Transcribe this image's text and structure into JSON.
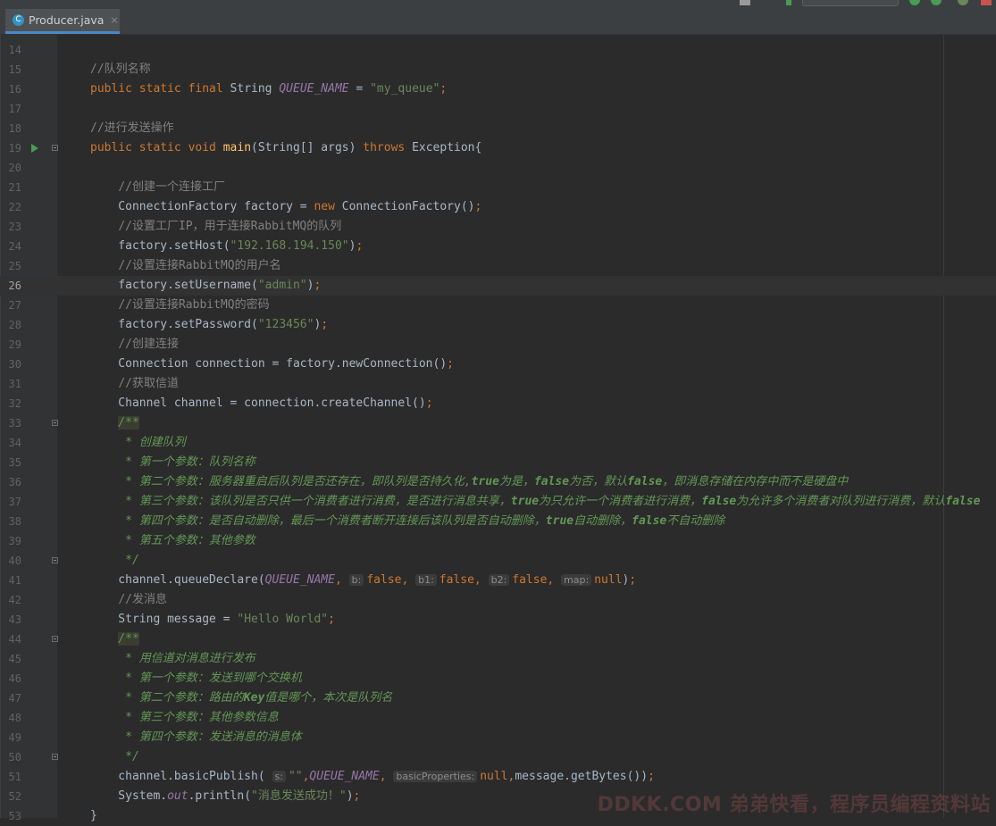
{
  "editor": {
    "tab": {
      "filename": "Producer.java",
      "icon": "java-class-icon",
      "close_glyph": "×"
    },
    "current_line": 26
  },
  "watermark": "DDKK.COM 弟弟快看，程序员编程资料站",
  "lines": [
    {
      "n": "14",
      "tokens": []
    },
    {
      "n": "15",
      "tokens": [
        {
          "c": "cmt",
          "t": "//队列名称"
        }
      ]
    },
    {
      "n": "16",
      "tokens": [
        {
          "c": "kw",
          "t": "public static final "
        },
        {
          "c": "cl",
          "t": "String "
        },
        {
          "c": "fld",
          "t": "QUEUE_NAME"
        },
        {
          "c": "plain",
          "t": " = "
        },
        {
          "c": "str",
          "t": "\"my_queue\""
        },
        {
          "c": "kw",
          "t": ";"
        }
      ]
    },
    {
      "n": "17",
      "tokens": []
    },
    {
      "n": "18",
      "tokens": [
        {
          "c": "cmt",
          "t": "//进行发送操作"
        }
      ]
    },
    {
      "n": "19",
      "run": true,
      "fold": true,
      "tokens": [
        {
          "c": "kw",
          "t": "public static void "
        },
        {
          "c": "mth",
          "t": "main"
        },
        {
          "c": "plain",
          "t": "(String[] args) "
        },
        {
          "c": "kw",
          "t": "throws "
        },
        {
          "c": "plain",
          "t": "Exception{"
        }
      ]
    },
    {
      "n": "20",
      "tokens": []
    },
    {
      "n": "21",
      "tokens": [
        {
          "c": "plain",
          "t": "    "
        },
        {
          "c": "cmt",
          "t": "//创建一个连接工厂"
        }
      ]
    },
    {
      "n": "22",
      "tokens": [
        {
          "c": "plain",
          "t": "    ConnectionFactory factory = "
        },
        {
          "c": "kw",
          "t": "new "
        },
        {
          "c": "plain",
          "t": "ConnectionFactory()"
        },
        {
          "c": "kw",
          "t": ";"
        }
      ]
    },
    {
      "n": "23",
      "tokens": [
        {
          "c": "plain",
          "t": "    "
        },
        {
          "c": "cmt",
          "t": "//设置工厂IP，用于连接RabbitMQ的队列"
        }
      ]
    },
    {
      "n": "24",
      "tokens": [
        {
          "c": "plain",
          "t": "    factory.setHost("
        },
        {
          "c": "str",
          "t": "\"192.168.194.150\""
        },
        {
          "c": "plain",
          "t": ")"
        },
        {
          "c": "kw",
          "t": ";"
        }
      ]
    },
    {
      "n": "25",
      "tokens": [
        {
          "c": "plain",
          "t": "    "
        },
        {
          "c": "cmt",
          "t": "//设置连接RabbitMQ的用户名"
        }
      ]
    },
    {
      "n": "26",
      "tokens": [
        {
          "c": "plain",
          "t": "    factory.setUsername("
        },
        {
          "c": "str",
          "t": "\"admin\""
        },
        {
          "c": "plain",
          "t": ")"
        },
        {
          "c": "kw",
          "t": ";"
        }
      ]
    },
    {
      "n": "27",
      "tokens": [
        {
          "c": "plain",
          "t": "    "
        },
        {
          "c": "cmt",
          "t": "//设置连接RabbitMQ的密码"
        }
      ]
    },
    {
      "n": "28",
      "tokens": [
        {
          "c": "plain",
          "t": "    factory.setPassword("
        },
        {
          "c": "str",
          "t": "\"123456\""
        },
        {
          "c": "plain",
          "t": ")"
        },
        {
          "c": "kw",
          "t": ";"
        }
      ]
    },
    {
      "n": "29",
      "tokens": [
        {
          "c": "plain",
          "t": "    "
        },
        {
          "c": "cmt",
          "t": "//创建连接"
        }
      ]
    },
    {
      "n": "30",
      "tokens": [
        {
          "c": "plain",
          "t": "    Connection connection = factory.newConnection()"
        },
        {
          "c": "kw",
          "t": ";"
        }
      ]
    },
    {
      "n": "31",
      "tokens": [
        {
          "c": "plain",
          "t": "    "
        },
        {
          "c": "cmt",
          "t": "//获取信道"
        }
      ]
    },
    {
      "n": "32",
      "tokens": [
        {
          "c": "plain",
          "t": "    Channel channel = connection.createChannel()"
        },
        {
          "c": "kw",
          "t": ";"
        }
      ]
    },
    {
      "n": "33",
      "fold": true,
      "tokens": [
        {
          "c": "plain",
          "t": "    "
        },
        {
          "c": "docs",
          "t": "/**"
        }
      ]
    },
    {
      "n": "34",
      "tokens": [
        {
          "c": "doc",
          "t": "     * 创建队列"
        }
      ]
    },
    {
      "n": "35",
      "tokens": [
        {
          "c": "doc",
          "t": "     * 第一个参数：队列名称"
        }
      ]
    },
    {
      "n": "36",
      "tokens": [
        {
          "c": "doc",
          "t": "     * 第二个参数：服务器重启后队列是否还存在，即队列是否持久化,"
        },
        {
          "c": "doc-b",
          "t": "true"
        },
        {
          "c": "doc",
          "t": "为是，"
        },
        {
          "c": "doc-b",
          "t": "false"
        },
        {
          "c": "doc",
          "t": "为否，默认"
        },
        {
          "c": "doc-b",
          "t": "false"
        },
        {
          "c": "doc",
          "t": "，即消息存储在内存中而不是硬盘中"
        }
      ]
    },
    {
      "n": "37",
      "tokens": [
        {
          "c": "doc",
          "t": "     * 第三个参数：该队列是否只供一个消费者进行消费，是否进行消息共享，"
        },
        {
          "c": "doc-b",
          "t": "true"
        },
        {
          "c": "doc",
          "t": "为只允许一个消费者进行消费，"
        },
        {
          "c": "doc-b",
          "t": "false"
        },
        {
          "c": "doc",
          "t": "为允许多个消费者对队列进行消费，默认"
        },
        {
          "c": "doc-b",
          "t": "false"
        }
      ]
    },
    {
      "n": "38",
      "tokens": [
        {
          "c": "doc",
          "t": "     * 第四个参数：是否自动删除，最后一个消费者断开连接后该队列是否自动删除，"
        },
        {
          "c": "doc-b",
          "t": "true"
        },
        {
          "c": "doc",
          "t": "自动删除，"
        },
        {
          "c": "doc-b",
          "t": "false"
        },
        {
          "c": "doc",
          "t": "不自动删除"
        }
      ]
    },
    {
      "n": "39",
      "tokens": [
        {
          "c": "doc",
          "t": "     * 第五个参数：其他参数"
        }
      ]
    },
    {
      "n": "40",
      "fold": true,
      "tokens": [
        {
          "c": "doc",
          "t": "     */"
        }
      ]
    },
    {
      "n": "41",
      "tokens": [
        {
          "c": "plain",
          "t": "    channel.queueDeclare("
        },
        {
          "c": "fld",
          "t": "QUEUE_NAME"
        },
        {
          "c": "kw",
          "t": ", "
        },
        {
          "c": "hint",
          "t": "b:"
        },
        {
          "c": "kw",
          "t": "false, "
        },
        {
          "c": "hint",
          "t": "b1:"
        },
        {
          "c": "kw",
          "t": "false, "
        },
        {
          "c": "hint",
          "t": "b2:"
        },
        {
          "c": "kw",
          "t": "false, "
        },
        {
          "c": "hint",
          "t": "map:"
        },
        {
          "c": "kw",
          "t": "null"
        },
        {
          "c": "plain",
          "t": ")"
        },
        {
          "c": "kw",
          "t": ";"
        }
      ]
    },
    {
      "n": "42",
      "tokens": [
        {
          "c": "plain",
          "t": "    "
        },
        {
          "c": "cmt",
          "t": "//发消息"
        }
      ]
    },
    {
      "n": "43",
      "tokens": [
        {
          "c": "plain",
          "t": "    String message = "
        },
        {
          "c": "str",
          "t": "\"Hello World\""
        },
        {
          "c": "kw",
          "t": ";"
        }
      ]
    },
    {
      "n": "44",
      "fold": true,
      "tokens": [
        {
          "c": "plain",
          "t": "    "
        },
        {
          "c": "docs",
          "t": "/**"
        }
      ]
    },
    {
      "n": "45",
      "tokens": [
        {
          "c": "doc",
          "t": "     * 用信道对消息进行发布"
        }
      ]
    },
    {
      "n": "46",
      "tokens": [
        {
          "c": "doc",
          "t": "     * 第一个参数：发送到哪个交换机"
        }
      ]
    },
    {
      "n": "47",
      "tokens": [
        {
          "c": "doc",
          "t": "     * 第二个参数：路由的"
        },
        {
          "c": "doc-b",
          "t": "Key"
        },
        {
          "c": "doc",
          "t": "值是哪个，本次是队列名"
        }
      ]
    },
    {
      "n": "48",
      "tokens": [
        {
          "c": "doc",
          "t": "     * 第三个参数：其他参数信息"
        }
      ]
    },
    {
      "n": "49",
      "tokens": [
        {
          "c": "doc",
          "t": "     * 第四个参数：发送消息的消息体"
        }
      ]
    },
    {
      "n": "50",
      "fold": true,
      "tokens": [
        {
          "c": "doc",
          "t": "     */"
        }
      ]
    },
    {
      "n": "51",
      "tokens": [
        {
          "c": "plain",
          "t": "    channel.basicPublish( "
        },
        {
          "c": "hint",
          "t": "s:"
        },
        {
          "c": "str",
          "t": "\"\""
        },
        {
          "c": "kw",
          "t": ","
        },
        {
          "c": "fld",
          "t": "QUEUE_NAME"
        },
        {
          "c": "kw",
          "t": ", "
        },
        {
          "c": "hint",
          "t": "basicProperties:"
        },
        {
          "c": "kw",
          "t": "null,"
        },
        {
          "c": "plain",
          "t": "message.getBytes())"
        },
        {
          "c": "kw",
          "t": ";"
        }
      ]
    },
    {
      "n": "52",
      "tokens": [
        {
          "c": "plain",
          "t": "    System."
        },
        {
          "c": "fld",
          "t": "out"
        },
        {
          "c": "plain",
          "t": ".println("
        },
        {
          "c": "str",
          "t": "\"消息发送成功！\""
        },
        {
          "c": "plain",
          "t": ")"
        },
        {
          "c": "kw",
          "t": ";"
        }
      ]
    },
    {
      "n": "53",
      "tokens": [
        {
          "c": "plain",
          "t": "}"
        }
      ]
    }
  ]
}
